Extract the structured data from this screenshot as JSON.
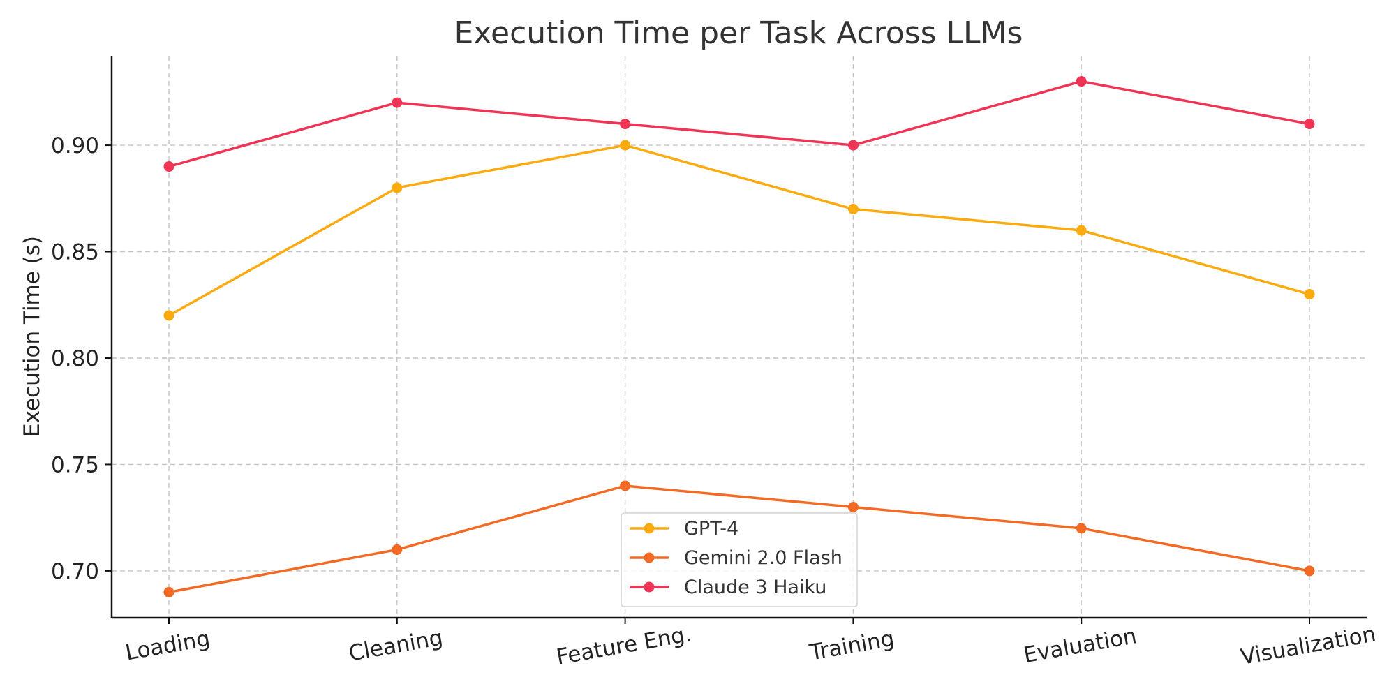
{
  "chart_data": {
    "type": "line",
    "title": "Execution Time per Task Across LLMs",
    "xlabel": "",
    "ylabel": "Execution Time (s)",
    "categories": [
      "Loading",
      "Cleaning",
      "Feature Eng.",
      "Training",
      "Evaluation",
      "Visualization"
    ],
    "ylim": [
      0.678,
      0.942
    ],
    "yticks": [
      0.7,
      0.75,
      0.8,
      0.85,
      0.9
    ],
    "ytick_labels": [
      "0.70",
      "0.75",
      "0.80",
      "0.85",
      "0.90"
    ],
    "grid": true,
    "legend_position": "bottom-center",
    "series": [
      {
        "name": "GPT-4",
        "color": "#FBAA10",
        "values": [
          0.82,
          0.88,
          0.9,
          0.87,
          0.86,
          0.83
        ]
      },
      {
        "name": "Gemini 2.0 Flash",
        "color": "#F26A24",
        "values": [
          0.69,
          0.71,
          0.74,
          0.73,
          0.72,
          0.7
        ]
      },
      {
        "name": "Claude 3 Haiku",
        "color": "#F03455",
        "values": [
          0.89,
          0.92,
          0.91,
          0.9,
          0.93,
          0.91
        ]
      }
    ]
  }
}
